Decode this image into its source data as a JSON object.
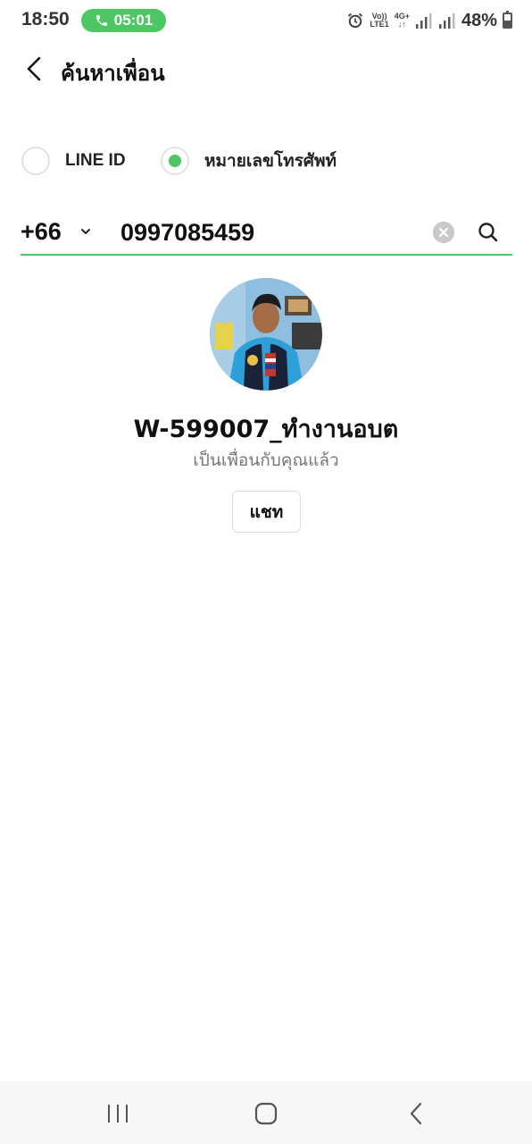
{
  "status_bar": {
    "time": "18:50",
    "call_timer": "05:01",
    "volte_label": "Vo))",
    "lte_label": "LTE1",
    "network_label": "4G+",
    "battery_percent": "48%",
    "battery_level": 0.48,
    "call_pill_color": "#4cc764"
  },
  "header": {
    "title": "ค้นหาเพื่อน"
  },
  "search_type": {
    "options": [
      {
        "label": "LINE ID",
        "selected": false
      },
      {
        "label": "หมายเลขโทรศัพท์",
        "selected": true
      }
    ]
  },
  "phone_search": {
    "country_code": "+66",
    "value": "0997085459"
  },
  "result": {
    "name": "W-599007_ทำงานอบต",
    "status": "เป็นเพื่อนกับคุณแล้ว",
    "chat_button_label": "แชท"
  },
  "icons": {
    "back": "chevron-left-icon",
    "country_dropdown": "chevron-down-icon",
    "clear": "close-circle-icon",
    "search": "search-icon",
    "nav_recent": "recent-apps-icon",
    "nav_home": "home-icon",
    "nav_back": "back-icon"
  },
  "colors": {
    "accent": "#4cc764",
    "text_primary": "#111111",
    "text_secondary": "#777777"
  }
}
